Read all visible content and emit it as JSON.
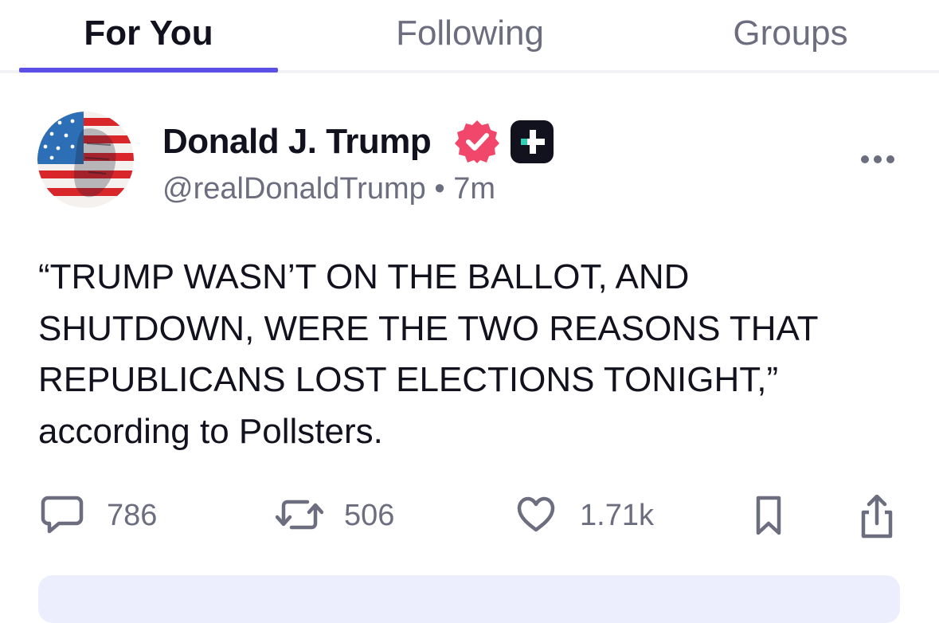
{
  "tabs": [
    {
      "label": "For You",
      "active": true
    },
    {
      "label": "Following",
      "active": false
    },
    {
      "label": "Groups",
      "active": false
    }
  ],
  "colors": {
    "accent": "#5a50e6",
    "verified": "#f0476b",
    "muted_text": "#6d6d80",
    "primary_text": "#12121f",
    "card_background": "#eceefd"
  },
  "post": {
    "author": {
      "name": "Donald J. Trump",
      "handle": "@realDonaldTrump",
      "time": "7m",
      "avatar_icon": "flag-face-avatar",
      "verified_icon": "verified-badge-icon",
      "extra_icon": "truth-plus-icon"
    },
    "body_lines": [
      "“TRUMP WASN’T ON THE BALLOT, AND",
      "SHUTDOWN, WERE THE TWO REASONS THAT",
      "REPUBLICANS LOST ELECTIONS TONIGHT,”",
      "according to Pollsters."
    ],
    "actions": {
      "replies": "786",
      "retruths": "506",
      "likes": "1.71k"
    }
  }
}
